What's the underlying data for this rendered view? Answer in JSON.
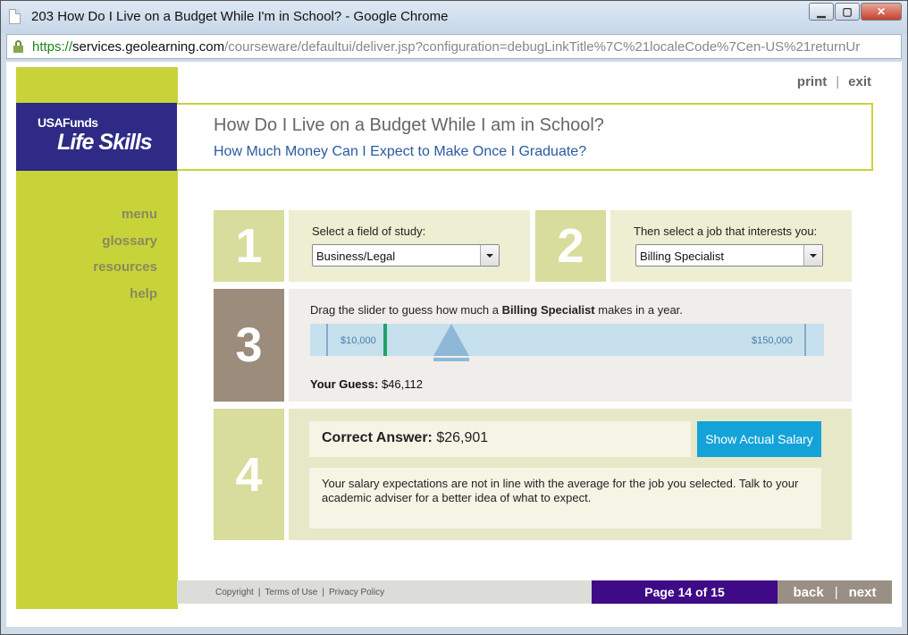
{
  "window": {
    "title": "203 How Do I Live on a Budget While I'm in School? - Google Chrome",
    "url_scheme": "https://",
    "url_host": "services.geolearning.com",
    "url_path": "/courseware/defaultui/deliver.jsp?configuration=debugLinkTitle%7C%21localeCode%7Cen-US%21returnUr"
  },
  "logo": {
    "line1": "USAFunds",
    "line2": "Life Skills"
  },
  "top_links": {
    "print": "print",
    "exit": "exit",
    "sep": "|"
  },
  "header": {
    "title": "How Do I Live on a Budget While I am in School?",
    "subtitle": "How Much Money Can I Expect to Make Once I Graduate?"
  },
  "left_nav": [
    "menu",
    "glossary",
    "resources",
    "help"
  ],
  "step1": {
    "number": "1",
    "label": "Select a field of study:",
    "value": "Business/Legal"
  },
  "step2": {
    "number": "2",
    "label": "Then select a job that interests you:",
    "value": "Billing Specialist"
  },
  "step3": {
    "number": "3",
    "instruction_pre": "Drag the slider to guess how much a ",
    "job": "Billing Specialist",
    "instruction_post": " makes in a year.",
    "min_label": "$10,000",
    "max_label": "$150,000",
    "guess_label": "Your Guess:",
    "guess_value": "$46,112"
  },
  "step4": {
    "number": "4",
    "answer_label": "Correct Answer:",
    "answer_value": "$26,901",
    "button": "Show Actual Salary",
    "feedback": "Your salary expectations are not in line with the average for the job you selected. Talk to your academic adviser for a better idea of what to expect."
  },
  "footer": {
    "copyright": "Copyright",
    "terms": "Terms of Use",
    "privacy": "Privacy Policy",
    "sep": "|",
    "page_count": "Page 14 of 15",
    "back": "back",
    "next": "next"
  },
  "colors": {
    "lime": "#c8d33a",
    "navy": "#2e2a86",
    "purple": "#3e0a86",
    "blue_button": "#14a3d8",
    "step_light": "#d8dc9c",
    "step_dark": "#9b8c7c"
  }
}
